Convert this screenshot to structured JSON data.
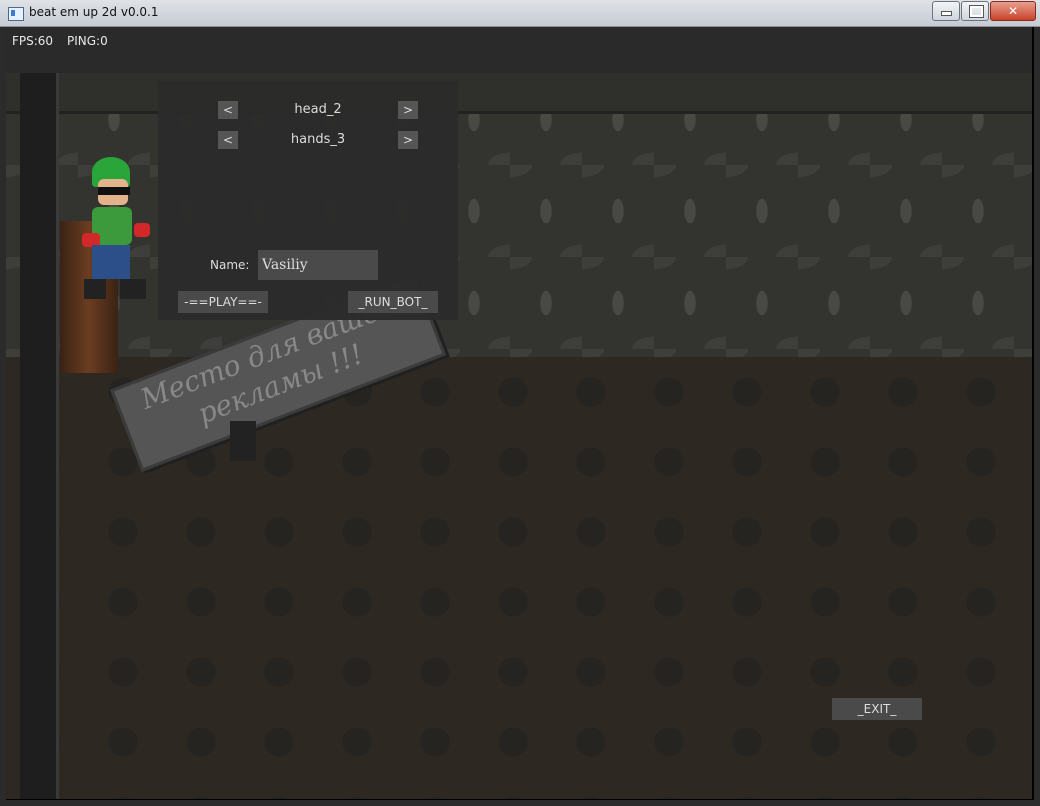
{
  "window": {
    "title": "beat em up 2d v0.0.1"
  },
  "hud": {
    "fps": "FPS:60",
    "ping": "PING:0"
  },
  "customize": {
    "rows": [
      {
        "prev": "<",
        "value": "head_2",
        "next": ">"
      },
      {
        "prev": "<",
        "value": "hands_3",
        "next": ">"
      }
    ],
    "name_label": "Name:",
    "name_value": "Vasiliy",
    "play_button": "-==PLAY==-",
    "bot_button": "_RUN_BOT_"
  },
  "sign": {
    "text": "Место для вашей рекламы !!!"
  },
  "exit_button": "_EXIT_",
  "colors": {
    "panel_bg": "#2b2b2b",
    "button_bg": "#4a4a4a",
    "text": "#dddddd",
    "hair": "#2aa53a",
    "gloves": "#d3282a"
  },
  "icons": {
    "app": "app-window-icon",
    "minimize": "minimize-icon",
    "maximize": "maximize-icon",
    "close": "close-icon"
  }
}
